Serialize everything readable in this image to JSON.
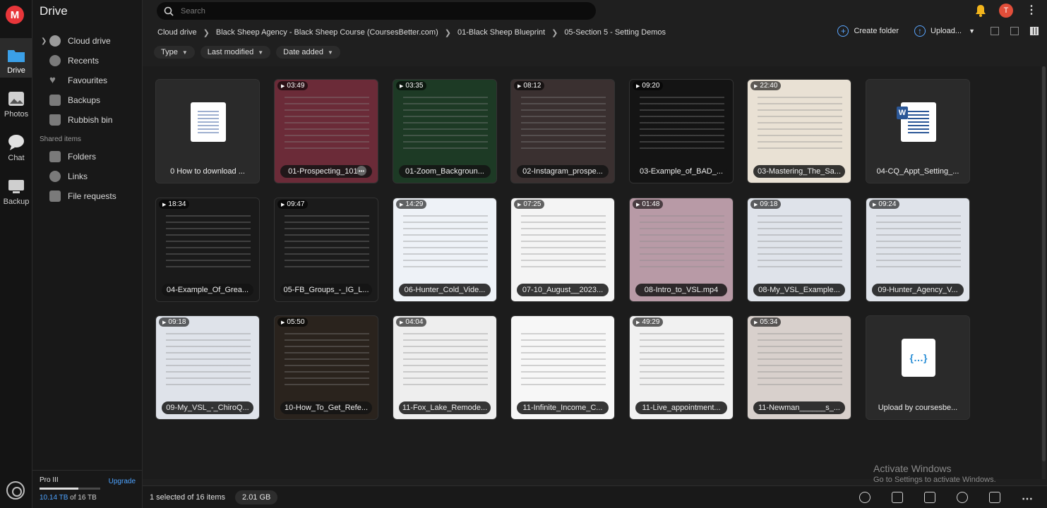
{
  "rail": {
    "logo": "M",
    "items": [
      {
        "label": "Drive"
      },
      {
        "label": "Photos"
      },
      {
        "label": "Chat"
      },
      {
        "label": "Backup"
      }
    ]
  },
  "sidebar": {
    "title": "Drive",
    "items": [
      {
        "label": "Cloud drive"
      },
      {
        "label": "Recents"
      },
      {
        "label": "Favourites"
      },
      {
        "label": "Backups"
      },
      {
        "label": "Rubbish bin"
      }
    ],
    "shared_section": "Shared items",
    "shared_items": [
      {
        "label": "Folders"
      },
      {
        "label": "Links"
      },
      {
        "label": "File requests"
      }
    ],
    "storage": {
      "plan": "Pro III",
      "upgrade": "Upgrade",
      "used_amount": "10.14 TB",
      "used_suffix": " of 16 TB",
      "used_fraction": 0.634
    }
  },
  "search": {
    "placeholder": "Search"
  },
  "header": {
    "avatar_initial": "T"
  },
  "breadcrumb": [
    "Cloud drive",
    "Black Sheep Agency - Black Sheep Course (CoursesBetter.com)",
    "01-Black Sheep Blueprint",
    "05-Section 5 - Setting Demos"
  ],
  "actions": {
    "create_folder": "Create folder",
    "upload": "Upload..."
  },
  "filters": [
    "Type",
    "Last modified",
    "Date added"
  ],
  "files": [
    {
      "name": "0 How to download ...",
      "duration": "",
      "kind": "doc",
      "bg": "#2a2a2a"
    },
    {
      "name": "01-Prospecting_101...",
      "duration": "03:49",
      "kind": "video",
      "bg": "#6b2b38"
    },
    {
      "name": "01-Zoom_Backgroun...",
      "duration": "03:35",
      "kind": "video",
      "bg": "#1d3a25"
    },
    {
      "name": "02-Instagram_prospe...",
      "duration": "08:12",
      "kind": "video",
      "bg": "#3a3030"
    },
    {
      "name": "03-Example_of_BAD_...",
      "duration": "09:20",
      "kind": "video",
      "bg": "#141414"
    },
    {
      "name": "03-Mastering_The_Sa...",
      "duration": "22:40",
      "kind": "video",
      "bg": "#e9e1d4"
    },
    {
      "name": "04-CQ_Appt_Setting_...",
      "duration": "",
      "kind": "word",
      "bg": "#2a2a2a"
    },
    {
      "name": "04-Example_Of_Grea...",
      "duration": "18:34",
      "kind": "video",
      "bg": "#1a1a1a"
    },
    {
      "name": "05-FB_Groups_-_IG_L...",
      "duration": "09:47",
      "kind": "video",
      "bg": "#1b1b1b"
    },
    {
      "name": "06-Hunter_Cold_Vide...",
      "duration": "14:29",
      "kind": "video",
      "bg": "#eef2f7"
    },
    {
      "name": "07-10_August__2023...",
      "duration": "07:25",
      "kind": "video",
      "bg": "#f4f4f4"
    },
    {
      "name": "08-Intro_to_VSL.mp4",
      "duration": "01:48",
      "kind": "video",
      "bg": "#b89aa6"
    },
    {
      "name": "08-My_VSL_Example...",
      "duration": "09:18",
      "kind": "video",
      "bg": "#dfe3ea"
    },
    {
      "name": "09-Hunter_Agency_V...",
      "duration": "09:24",
      "kind": "video",
      "bg": "#dfe3ea"
    },
    {
      "name": "09-My_VSL_-_ChiroQ...",
      "duration": "09:18",
      "kind": "video",
      "bg": "#dfe3ea"
    },
    {
      "name": "10-How_To_Get_Refe...",
      "duration": "05:50",
      "kind": "video",
      "bg": "#2a231d"
    },
    {
      "name": "11-Fox_Lake_Remode...",
      "duration": "04:04",
      "kind": "video",
      "bg": "#eeeeee"
    },
    {
      "name": "11-Infinite_Income_C...",
      "duration": "",
      "kind": "page",
      "bg": "#f7f7f7"
    },
    {
      "name": "11-Live_appointment...",
      "duration": "49:29",
      "kind": "video",
      "bg": "#f1f1f1"
    },
    {
      "name": "11-Newman______s_...",
      "duration": "05:34",
      "kind": "video",
      "bg": "#d8d0cc"
    },
    {
      "name": "Upload by coursesbe...",
      "duration": "",
      "kind": "json",
      "bg": "#2a2a2a"
    }
  ],
  "footer": {
    "selection": "1 selected of 16 items",
    "size": "2.01 GB"
  },
  "watermark": {
    "line1": "Activate Windows",
    "line2": "Go to Settings to activate Windows."
  }
}
